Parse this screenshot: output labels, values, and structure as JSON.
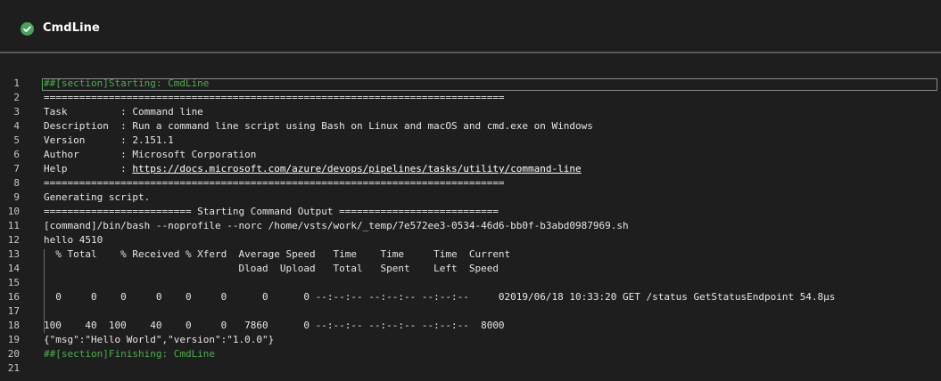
{
  "header": {
    "status_icon": "check-circle-icon",
    "status_color": "#47a35a",
    "title": "CmdLine"
  },
  "log": {
    "lines": [
      {
        "num": "1",
        "text": "##[section]Starting: CmdLine",
        "kind": "section"
      },
      {
        "num": "2",
        "text": "==============================================================================",
        "kind": "plain"
      },
      {
        "num": "3",
        "text": "Task         : Command line",
        "kind": "plain"
      },
      {
        "num": "4",
        "text": "Description  : Run a command line script using Bash on Linux and macOS and cmd.exe on Windows",
        "kind": "plain"
      },
      {
        "num": "5",
        "text": "Version      : 2.151.1",
        "kind": "plain"
      },
      {
        "num": "6",
        "text": "Author       : Microsoft Corporation",
        "kind": "plain"
      },
      {
        "num": "7",
        "text": "Help         : ",
        "kind": "plain",
        "link": "https://docs.microsoft.com/azure/devops/pipelines/tasks/utility/command-line"
      },
      {
        "num": "8",
        "text": "==============================================================================",
        "kind": "plain"
      },
      {
        "num": "9",
        "text": "Generating script.",
        "kind": "plain"
      },
      {
        "num": "10",
        "text": "========================= Starting Command Output ===========================",
        "kind": "plain"
      },
      {
        "num": "11",
        "text": "[command]/bin/bash --noprofile --norc /home/vsts/work/_temp/7e572ee3-0534-46d6-bb0f-b3abd0987969.sh",
        "kind": "plain"
      },
      {
        "num": "12",
        "text": "hello 4510",
        "kind": "plain"
      },
      {
        "num": "13",
        "text": "  % Total    % Received % Xferd  Average Speed   Time    Time     Time  Current",
        "kind": "plain"
      },
      {
        "num": "14",
        "text": "                                 Dload  Upload   Total   Spent    Left  Speed",
        "kind": "plain"
      },
      {
        "num": "15",
        "text": "",
        "kind": "plain"
      },
      {
        "num": "16",
        "text": "  0     0    0     0    0     0      0      0 --:--:-- --:--:-- --:--:--     02019/06/18 10:33:20 GET /status GetStatusEndpoint 54.8µs",
        "kind": "plain"
      },
      {
        "num": "17",
        "text": "",
        "kind": "plain"
      },
      {
        "num": "18",
        "text": "100    40  100    40    0     0   7860      0 --:--:-- --:--:-- --:--:--  8000",
        "kind": "plain"
      },
      {
        "num": "19",
        "text": "{\"msg\":\"Hello World\",\"version\":\"1.0.0\"}",
        "kind": "plain"
      },
      {
        "num": "20",
        "text": "##[section]Finishing: CmdLine",
        "kind": "section"
      },
      {
        "num": "21",
        "text": "",
        "kind": "plain"
      }
    ]
  },
  "colors": {
    "background": "#1e1e1e",
    "section_green": "#4cae4c",
    "text": "#e6e6e6",
    "line_number": "#c8c8c8"
  }
}
